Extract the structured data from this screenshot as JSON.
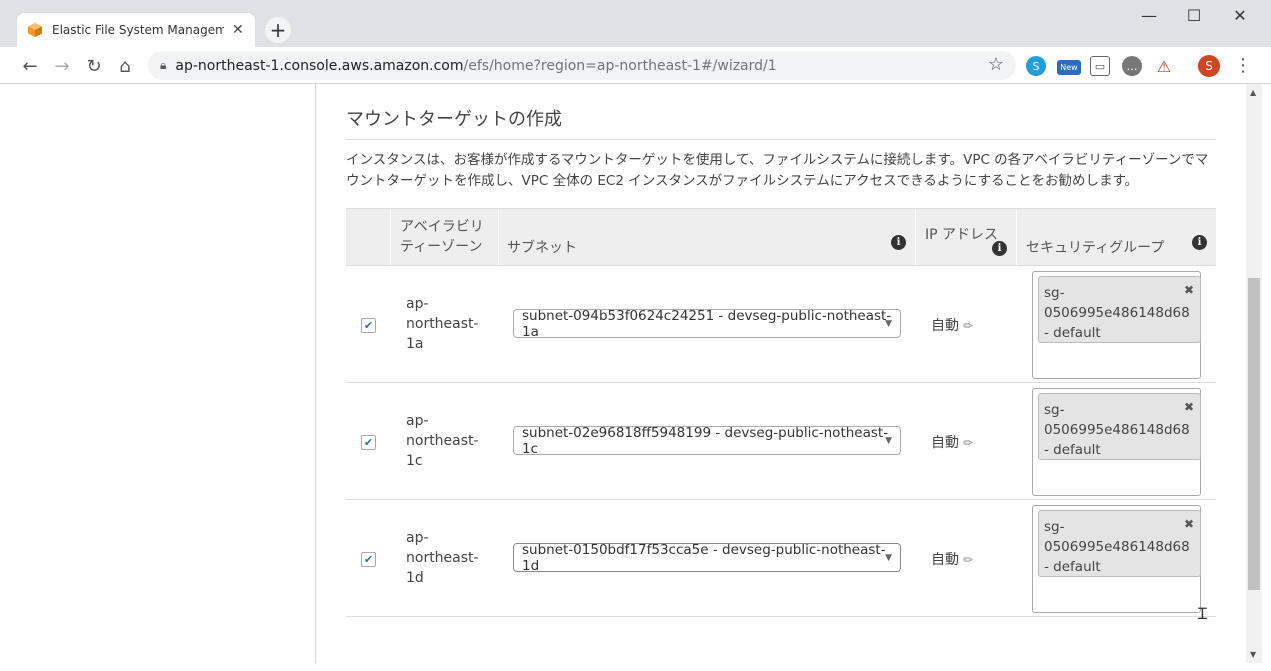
{
  "browser": {
    "tab_title": "Elastic File System Management C",
    "url_host": "ap-northeast-1.console.aws.amazon.com",
    "url_path": "/efs/home?region=ap-northeast-1#/wizard/1",
    "profile_initial": "S",
    "ext_new_label": "New"
  },
  "page": {
    "section_title": "マウントターゲットの作成",
    "description": "インスタンスは、お客様が作成するマウントターゲットを使用して、ファイルシステムに接続します。VPC の各アベイラビリティーゾーンでマウントターゲットを作成し、VPC 全体の EC2 インスタンスがファイルシステムにアクセスできるようにすることをお勧めします。",
    "table": {
      "headers": {
        "az_line1": "アベイラビリ",
        "az_line2": "ティーゾーン",
        "subnet": "サブネット",
        "ip": "IP アドレス",
        "sg": "セキュリティグループ"
      },
      "rows": [
        {
          "checked": true,
          "az": [
            "ap-",
            "northeast-",
            "1a"
          ],
          "subnet": "subnet-094b53f0624c24251 - devseg-public-notheast-1a",
          "ip": "自動",
          "sg": [
            "sg-",
            "0506995e486148d68",
            "- default"
          ]
        },
        {
          "checked": true,
          "az": [
            "ap-",
            "northeast-",
            "1c"
          ],
          "subnet": "subnet-02e96818ff5948199 - devseg-public-notheast-1c",
          "ip": "自動",
          "sg": [
            "sg-",
            "0506995e486148d68",
            "- default"
          ]
        },
        {
          "checked": true,
          "az": [
            "ap-",
            "northeast-",
            "1d"
          ],
          "subnet": "subnet-0150bdf17f53cca5e - devseg-public-notheast-1d",
          "ip": "自動",
          "sg": [
            "sg-",
            "0506995e486148d68",
            "- default"
          ]
        }
      ]
    }
  },
  "colors": {
    "accent_orange": "#f7981f",
    "checkbox_blue": "#2a6fb0"
  }
}
